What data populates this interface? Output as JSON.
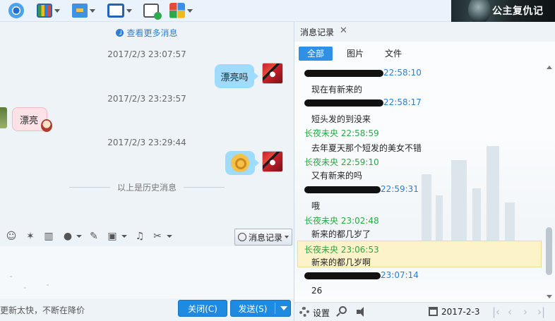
{
  "toolbar": {
    "items": [
      {
        "icon": "webcam-icon"
      },
      {
        "icon": "screen-share-icon"
      },
      {
        "icon": "send-file-icon"
      },
      {
        "icon": "remote-desktop-icon"
      },
      {
        "icon": "new-chat-icon"
      },
      {
        "icon": "apps-icon"
      }
    ],
    "cover_text": "公主复仇记"
  },
  "chat": {
    "more_messages": "查看更多消息",
    "messages": [
      {
        "timestamp": "2017/2/3 23:07:57",
        "side": "right",
        "text": "漂亮吗"
      },
      {
        "timestamp": "2017/2/3 23:23:57",
        "side": "left",
        "text": "漂亮"
      },
      {
        "timestamp": "2017/2/3 23:29:44",
        "side": "right",
        "text": ""
      }
    ],
    "history_divider": "以上是历史消息"
  },
  "input": {
    "history_button": "消息记录",
    "status_text": "更新太快，不断在降价",
    "close_button": "关闭(C)",
    "send_button": "发送(S)"
  },
  "history_panel": {
    "tab_title": "消息记录",
    "filters": [
      "全部",
      "图片",
      "文件"
    ],
    "active_filter": "全部",
    "records": [
      {
        "name": "",
        "time": "22:58:10",
        "text": "现在有新来的",
        "redacted": true
      },
      {
        "name": "",
        "time": "22:58:17",
        "text": "短头发的到没来",
        "redacted": true
      },
      {
        "name": "长夜未央",
        "time": "22:58:59",
        "text": "去年夏天那个短发的美女不错",
        "redacted": false
      },
      {
        "name": "长夜未央",
        "time": "22:59:10",
        "text": "又有新来的吗",
        "redacted": false
      },
      {
        "name": "",
        "time": "22:59:31",
        "text": "哦",
        "redacted": true
      },
      {
        "name": "长夜未央",
        "time": "23:02:48",
        "text": "新来的都几岁了",
        "redacted": false
      },
      {
        "name": "长夜未央",
        "time": "23:06:53",
        "text": "新来的都几岁啊",
        "redacted": false,
        "highlighted": true
      },
      {
        "name": "",
        "time": "23:07:14",
        "text": "26",
        "redacted": true
      }
    ],
    "footer": {
      "settings_label": "设置",
      "date": "2017-2-3"
    }
  },
  "colors": {
    "accent": "#2e90e6",
    "time_blue": "#2d7fd4",
    "name_green": "#28a745",
    "highlight_bg": "#fdf3c9",
    "my_bubble": "#9fdcfb",
    "their_bubble": "#fde3e8"
  }
}
